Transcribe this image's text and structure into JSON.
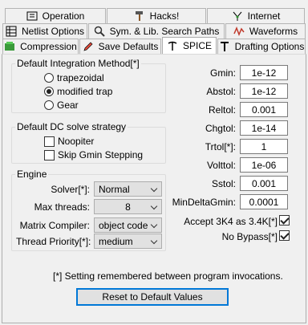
{
  "tabs": {
    "row1": [
      "Operation",
      "Hacks!",
      "Internet"
    ],
    "row2": [
      "Netlist Options",
      "Sym. & Lib. Search Paths",
      "Waveforms"
    ],
    "row3": [
      "Compression",
      "Save Defaults",
      "SPICE",
      "Drafting Options"
    ]
  },
  "integration": {
    "legend": "Default Integration Method[*]",
    "options": [
      "trapezoidal",
      "modified trap",
      "Gear"
    ],
    "selected": "modified trap"
  },
  "dc": {
    "legend": "Default DC solve strategy",
    "noopiter": "Noopiter",
    "skip_gmin": "Skip Gmin Stepping"
  },
  "engine": {
    "legend": "Engine",
    "solver_label": "Solver[*]:",
    "solver_value": "Normal",
    "threads_label": "Max threads:",
    "threads_value": "8",
    "compiler_label": "Matrix Compiler:",
    "compiler_value": "object code",
    "priority_label": "Thread Priority[*]:",
    "priority_value": "medium"
  },
  "params": [
    {
      "label": "Gmin:",
      "value": "1e-12"
    },
    {
      "label": "Abstol:",
      "value": "1e-12"
    },
    {
      "label": "Reltol:",
      "value": "0.001"
    },
    {
      "label": "Chgtol:",
      "value": "1e-14"
    },
    {
      "label": "Trtol[*]:",
      "value": "1"
    },
    {
      "label": "Volttol:",
      "value": "1e-06"
    },
    {
      "label": "Sstol:",
      "value": "0.001"
    },
    {
      "label": "MinDeltaGmin:",
      "value": "0.0001"
    }
  ],
  "accept_3k4": {
    "label": "Accept 3K4 as 3.4K[*]",
    "checked": true
  },
  "no_bypass": {
    "label": "No Bypass[*]",
    "checked": true
  },
  "footnote": "[*] Setting remembered between program invocations.",
  "reset_button": "Reset to Default Values"
}
